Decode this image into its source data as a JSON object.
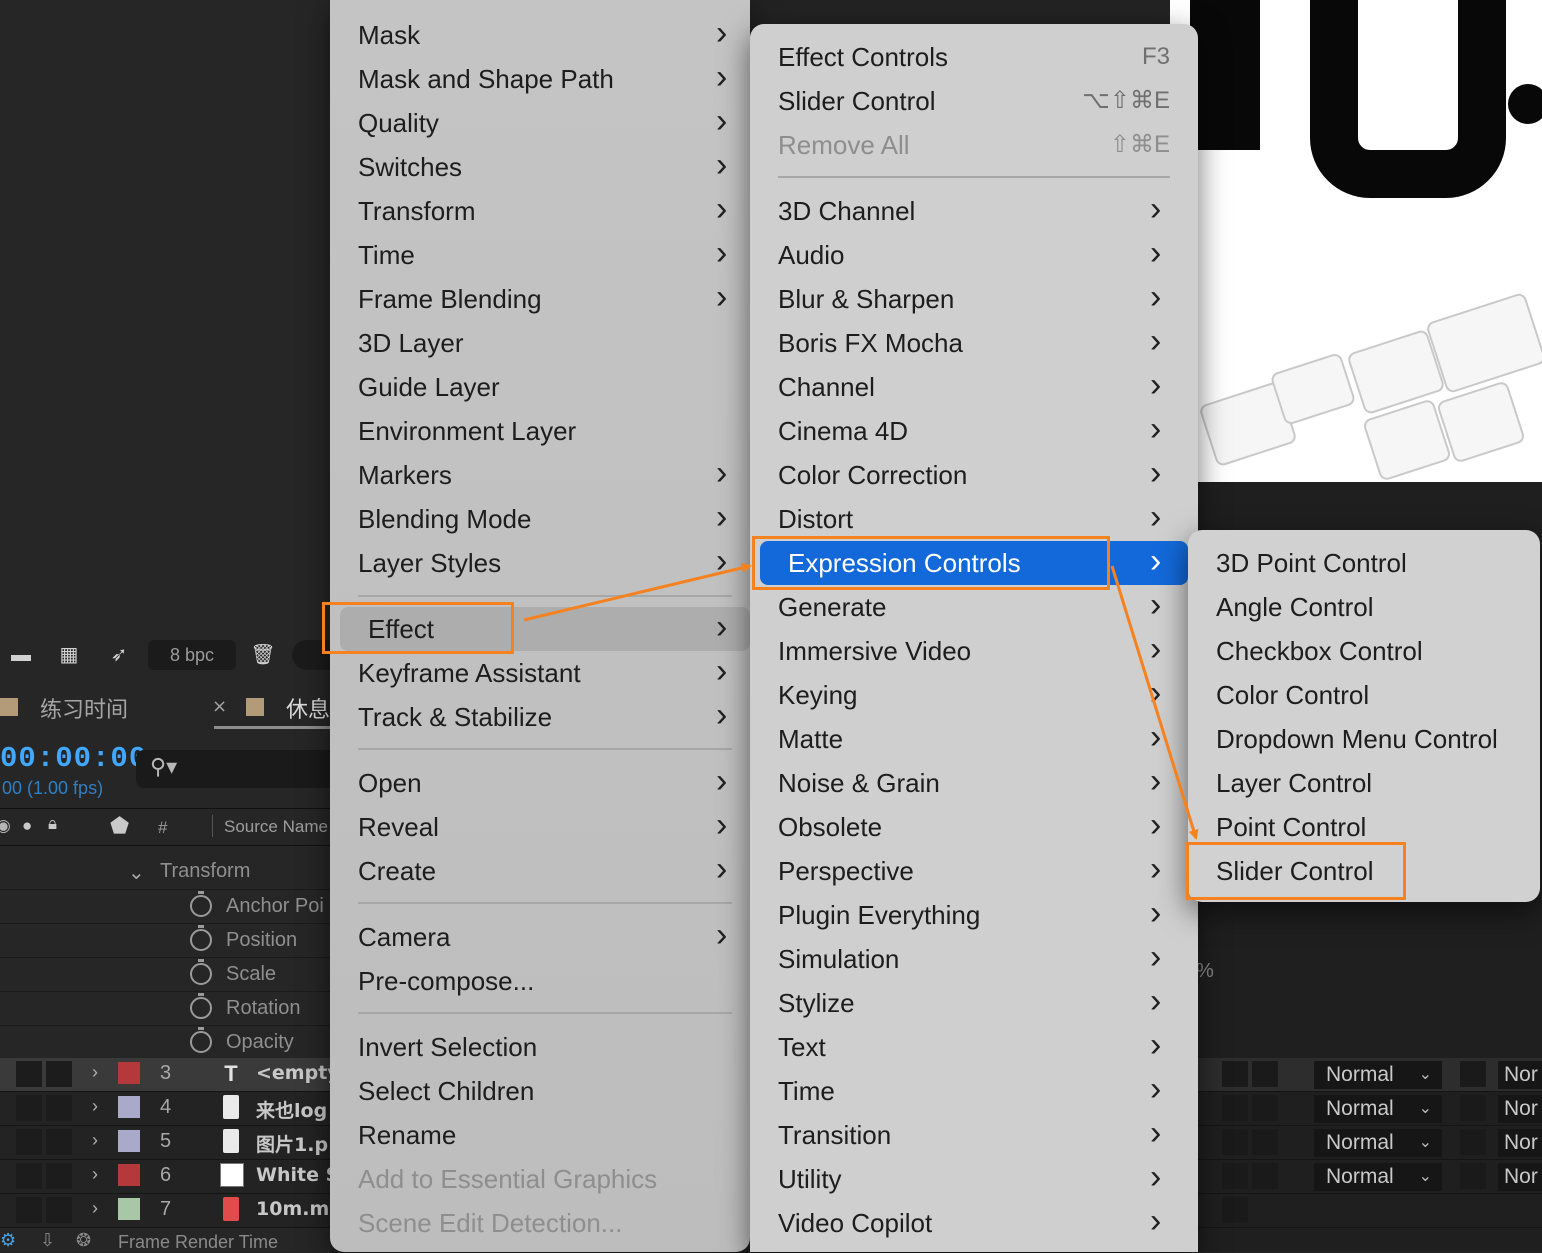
{
  "toolbar": {
    "bpc_label": "8 bpc"
  },
  "composition_tabs": [
    {
      "label": "练习时间"
    },
    {
      "label": "休息"
    }
  ],
  "timecode": "00:00:00",
  "fps": "00 (1.00 fps)",
  "columns": {
    "number": "#",
    "source_name": "Source Name"
  },
  "transform": {
    "label": "Transform",
    "properties": [
      "Anchor Poi",
      "Position",
      "Scale",
      "Rotation",
      "Opacity"
    ]
  },
  "layers": [
    {
      "num": "3",
      "name": "<empty",
      "label_color": "#b5393a",
      "icon": "T",
      "mode": "Normal",
      "mode2": "Nor"
    },
    {
      "num": "4",
      "name": "来也log",
      "label_color": "#a9a9cc",
      "icon": "image",
      "mode": "Normal",
      "mode2": "Nor"
    },
    {
      "num": "5",
      "name": "图片1.p",
      "label_color": "#a9a9cc",
      "icon": "image",
      "mode": "Normal",
      "mode2": "Nor"
    },
    {
      "num": "6",
      "name": "White S",
      "label_color": "#b5393a",
      "icon": "solid",
      "mode": "Normal",
      "mode2": "Nor"
    },
    {
      "num": "7",
      "name": "10m.m",
      "label_color": "#a7c7a7",
      "icon": "media",
      "mode": "",
      "mode2": ""
    }
  ],
  "footer": {
    "label": "Frame Render Time"
  },
  "right_panel": {
    "percent_label": "%"
  },
  "menu_layer": [
    {
      "label": "Mask",
      "submenu": true
    },
    {
      "label": "Mask and Shape Path",
      "submenu": true
    },
    {
      "label": "Quality",
      "submenu": true
    },
    {
      "label": "Switches",
      "submenu": true
    },
    {
      "label": "Transform",
      "submenu": true
    },
    {
      "label": "Time",
      "submenu": true
    },
    {
      "label": "Frame Blending",
      "submenu": true
    },
    {
      "label": "3D Layer",
      "submenu": false
    },
    {
      "label": "Guide Layer",
      "submenu": false
    },
    {
      "label": "Environment Layer",
      "submenu": false
    },
    {
      "label": "Markers",
      "submenu": true
    },
    {
      "label": "Blending Mode",
      "submenu": true
    },
    {
      "label": "Layer Styles",
      "submenu": true
    },
    {
      "label": "Effect",
      "submenu": true,
      "state": "hover"
    },
    {
      "label": "Keyframe Assistant",
      "submenu": true
    },
    {
      "label": "Track & Stabilize",
      "submenu": true
    },
    {
      "label": "Open",
      "submenu": true
    },
    {
      "label": "Reveal",
      "submenu": true
    },
    {
      "label": "Create",
      "submenu": true
    },
    {
      "label": "Camera",
      "submenu": true
    },
    {
      "label": "Pre-compose...",
      "submenu": false
    },
    {
      "label": "Invert Selection",
      "submenu": false
    },
    {
      "label": "Select Children",
      "submenu": false
    },
    {
      "label": "Rename",
      "submenu": false
    },
    {
      "label": "Add to Essential Graphics",
      "submenu": false,
      "disabled": true
    },
    {
      "label": "Scene Edit Detection...",
      "submenu": false,
      "disabled": true
    }
  ],
  "menu_effect": [
    {
      "label": "Effect Controls",
      "shortcut": "F3"
    },
    {
      "label": "Slider Control",
      "shortcut": "⌥⇧⌘E"
    },
    {
      "label": "Remove All",
      "shortcut": "⇧⌘E",
      "disabled": true
    },
    {
      "label": "3D Channel",
      "submenu": true
    },
    {
      "label": "Audio",
      "submenu": true
    },
    {
      "label": "Blur & Sharpen",
      "submenu": true
    },
    {
      "label": "Boris FX Mocha",
      "submenu": true
    },
    {
      "label": "Channel",
      "submenu": true
    },
    {
      "label": "Cinema 4D",
      "submenu": true
    },
    {
      "label": "Color Correction",
      "submenu": true
    },
    {
      "label": "Distort",
      "submenu": true
    },
    {
      "label": "Expression Controls",
      "submenu": true,
      "state": "active"
    },
    {
      "label": "Generate",
      "submenu": true
    },
    {
      "label": "Immersive Video",
      "submenu": true
    },
    {
      "label": "Keying",
      "submenu": true
    },
    {
      "label": "Matte",
      "submenu": true
    },
    {
      "label": "Noise & Grain",
      "submenu": true
    },
    {
      "label": "Obsolete",
      "submenu": true
    },
    {
      "label": "Perspective",
      "submenu": true
    },
    {
      "label": "Plugin Everything",
      "submenu": true
    },
    {
      "label": "Simulation",
      "submenu": true
    },
    {
      "label": "Stylize",
      "submenu": true
    },
    {
      "label": "Text",
      "submenu": true
    },
    {
      "label": "Time",
      "submenu": true
    },
    {
      "label": "Transition",
      "submenu": true
    },
    {
      "label": "Utility",
      "submenu": true
    },
    {
      "label": "Video Copilot",
      "submenu": true
    }
  ],
  "menu_expression_controls": [
    {
      "label": "3D Point Control"
    },
    {
      "label": "Angle Control"
    },
    {
      "label": "Checkbox Control"
    },
    {
      "label": "Color Control"
    },
    {
      "label": "Dropdown Menu Control"
    },
    {
      "label": "Layer Control"
    },
    {
      "label": "Point Control"
    },
    {
      "label": "Slider Control"
    }
  ],
  "colors": {
    "menu_highlight": "#1369da",
    "annotation": "#f5821f",
    "timecode": "#41a7ff"
  }
}
